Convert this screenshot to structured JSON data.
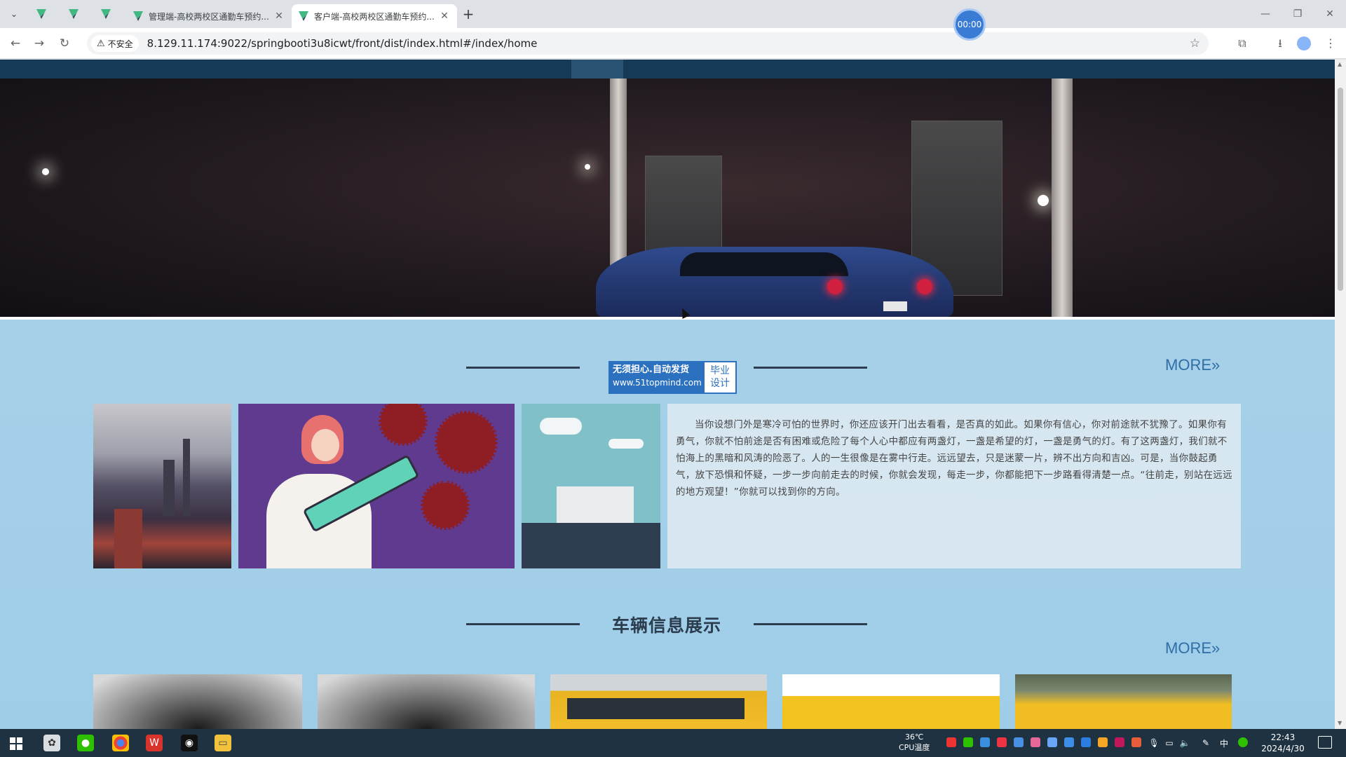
{
  "browser": {
    "tabs": [
      {
        "title": "管理端-高校两校区通勤车预约..."
      },
      {
        "title": "客户端-高校两校区通勤车预约..."
      }
    ],
    "new_tab": "+",
    "timer": "00:00",
    "security_label": "不安全",
    "url": "8.129.11.174:9022/springbooti3u8icwt/front/dist/index.html#/index/home"
  },
  "page": {
    "watermark": {
      "line1": "无须担心.自动发货",
      "line2": "www.51topmind.com",
      "badge1": "毕业",
      "badge2": "设计"
    },
    "section1": {
      "more": "MORE»",
      "text": "当你设想门外是寒冷可怕的世界时，你还应该开门出去看看，是否真的如此。如果你有信心，你对前途就不犹豫了。如果你有勇气，你就不怕前途是否有困难或危险了每个人心中都应有两盏灯，一盏是希望的灯，一盏是勇气的灯。有了这两盏灯，我们就不怕海上的黑暗和风涛的险恶了。人的一生很像是在雾中行走。远远望去，只是迷蒙一片，辨不出方向和吉凶。可是，当你鼓起勇气，放下恐惧和怀疑，一步一步向前走去的时候，你就会发现，每走一步，你都能把下一步路看得清楚一点。“往前走，别站在远远的地方观望！”你就可以找到你的方向。"
    },
    "section2": {
      "title": "车辆信息展示",
      "more": "MORE»"
    }
  },
  "taskbar": {
    "temp": "36℃",
    "temp_label": "CPU温度",
    "ime": "中",
    "time": "22:43",
    "date": "2024/4/30"
  }
}
